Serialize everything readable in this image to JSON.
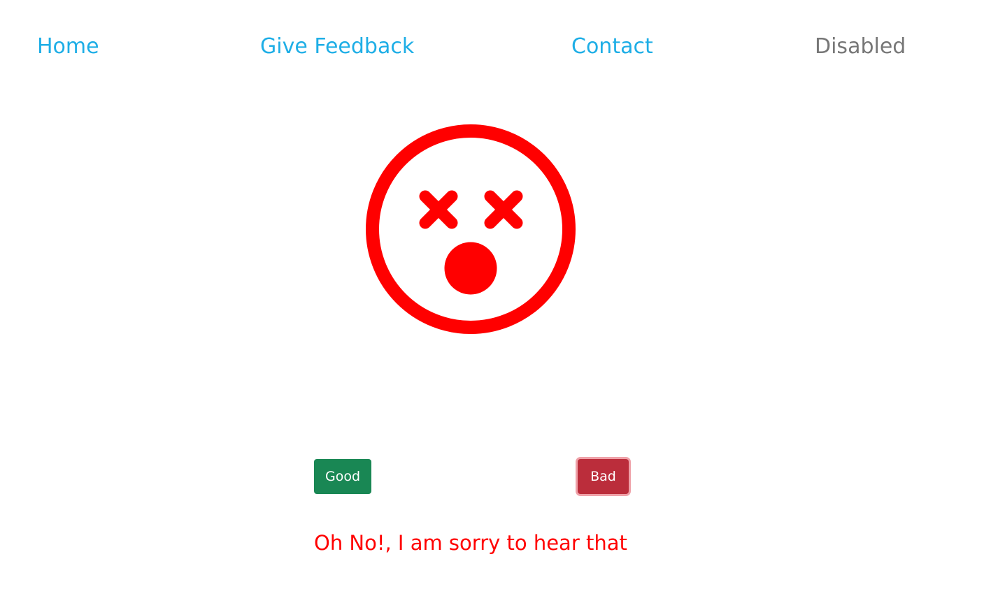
{
  "nav": {
    "home_label": "Home",
    "feedback_label": "Give Feedback",
    "contact_label": "Contact",
    "disabled_label": "Disabled"
  },
  "face": {
    "icon": "dizzy-face-icon",
    "color": "#ff0000"
  },
  "buttons": {
    "good_label": "Good",
    "bad_label": "Bad"
  },
  "colors": {
    "nav_active": "#1eaee6",
    "nav_disabled": "#777777",
    "good": "#198754",
    "bad": "#bb2d3b",
    "message": "#ff0000"
  },
  "message": {
    "text": "Oh No!, I am sorry to hear that"
  }
}
